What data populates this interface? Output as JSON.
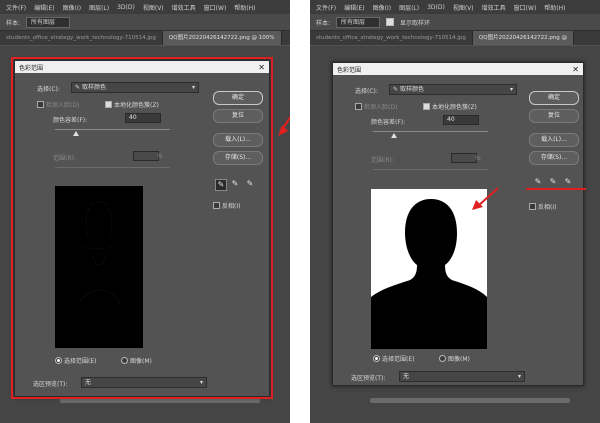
{
  "menu": [
    "文件(F)",
    "编辑(E)",
    "图像(I)",
    "图层(L)",
    "3D(D)",
    "视图(V)",
    "增效工具",
    "窗口(W)",
    "帮助(H)"
  ],
  "options_bar": {
    "sample_label": "样本:",
    "sample_value": "所有图层",
    "show_sampling_ring": "显示取样环"
  },
  "tabs": {
    "left_tab1": "students_office_strategy_work_technology-710514.jpg",
    "left_tab2": "QQ图片20220426142722.png @ 100%",
    "right_tab1": "students_office_strategy_work_technology-710514.jpg",
    "right_tab2": "QQ图片20220426142722.png @"
  },
  "dialog": {
    "title": "色彩范围",
    "select_label": "选择(C):",
    "select_value": "取样颜色",
    "detect_faces": "检测人脸(D)",
    "localized_clusters": "本地化颜色簇(Z)",
    "fuzziness_label": "颜色容差(F):",
    "left_fuzziness": "40",
    "right_fuzziness": "40",
    "range_label": "范围(R):",
    "range_unit": "%",
    "invert": "反相(I)",
    "radio_selection": "选择范围(E)",
    "radio_image": "图像(M)",
    "selection_preview_label": "选区预览(T):",
    "selection_preview_value": "无",
    "buttons": {
      "ok": "确定",
      "reset": "复位",
      "load": "载入(L)...",
      "save": "存储(S)..."
    }
  },
  "state": {
    "left_fuzziness_fraction": 0.18,
    "right_fuzziness_fraction": 0.18,
    "left_localized_checked": true,
    "right_localized_checked": true,
    "selection_radio": "selection"
  },
  "colors": {
    "highlight": "#e02020",
    "dialog_bg": "#535353"
  }
}
